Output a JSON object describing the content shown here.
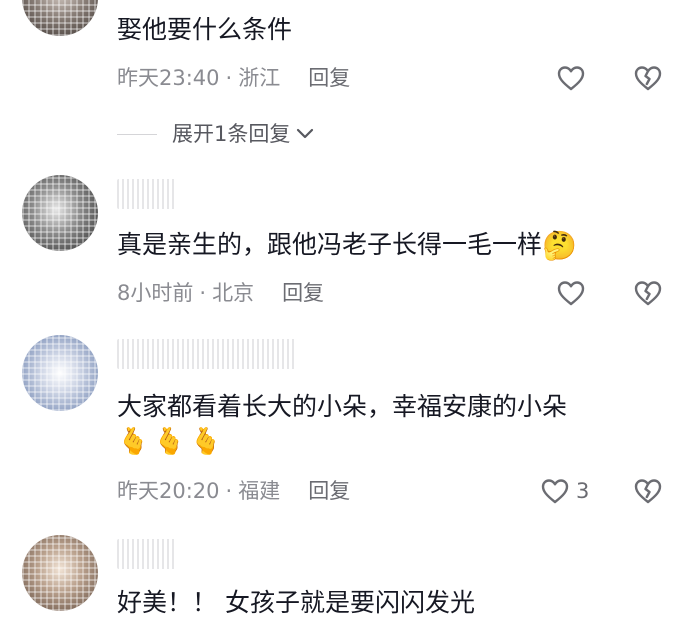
{
  "comments": [
    {
      "text": "娶他要什么条件",
      "time": "昨天23:40",
      "location": "浙江",
      "reply_label": "回复",
      "likes": ""
    },
    {
      "text": "真是亲生的，跟他冯老子长得一毛一样",
      "emoji": "🤔",
      "time": "8小时前",
      "location": "北京",
      "reply_label": "回复",
      "likes": ""
    },
    {
      "text": "大家都看着长大的小朵，幸福安康的小朵",
      "emoji_line": "🫰🫰🫰",
      "time": "昨天20:20",
      "location": "福建",
      "reply_label": "回复",
      "likes": "3"
    },
    {
      "text": "好美！！ 女孩子就是要闪闪发光"
    }
  ],
  "expand_replies": {
    "label": "展开1条回复"
  },
  "separator": "·",
  "icons": {
    "like": "heart-outline-icon",
    "dislike": "broken-heart-icon",
    "expand": "chevron-down-icon"
  },
  "colors": {
    "text": "#161823",
    "meta": "#8a8b91",
    "icon": "#6b6c72"
  }
}
